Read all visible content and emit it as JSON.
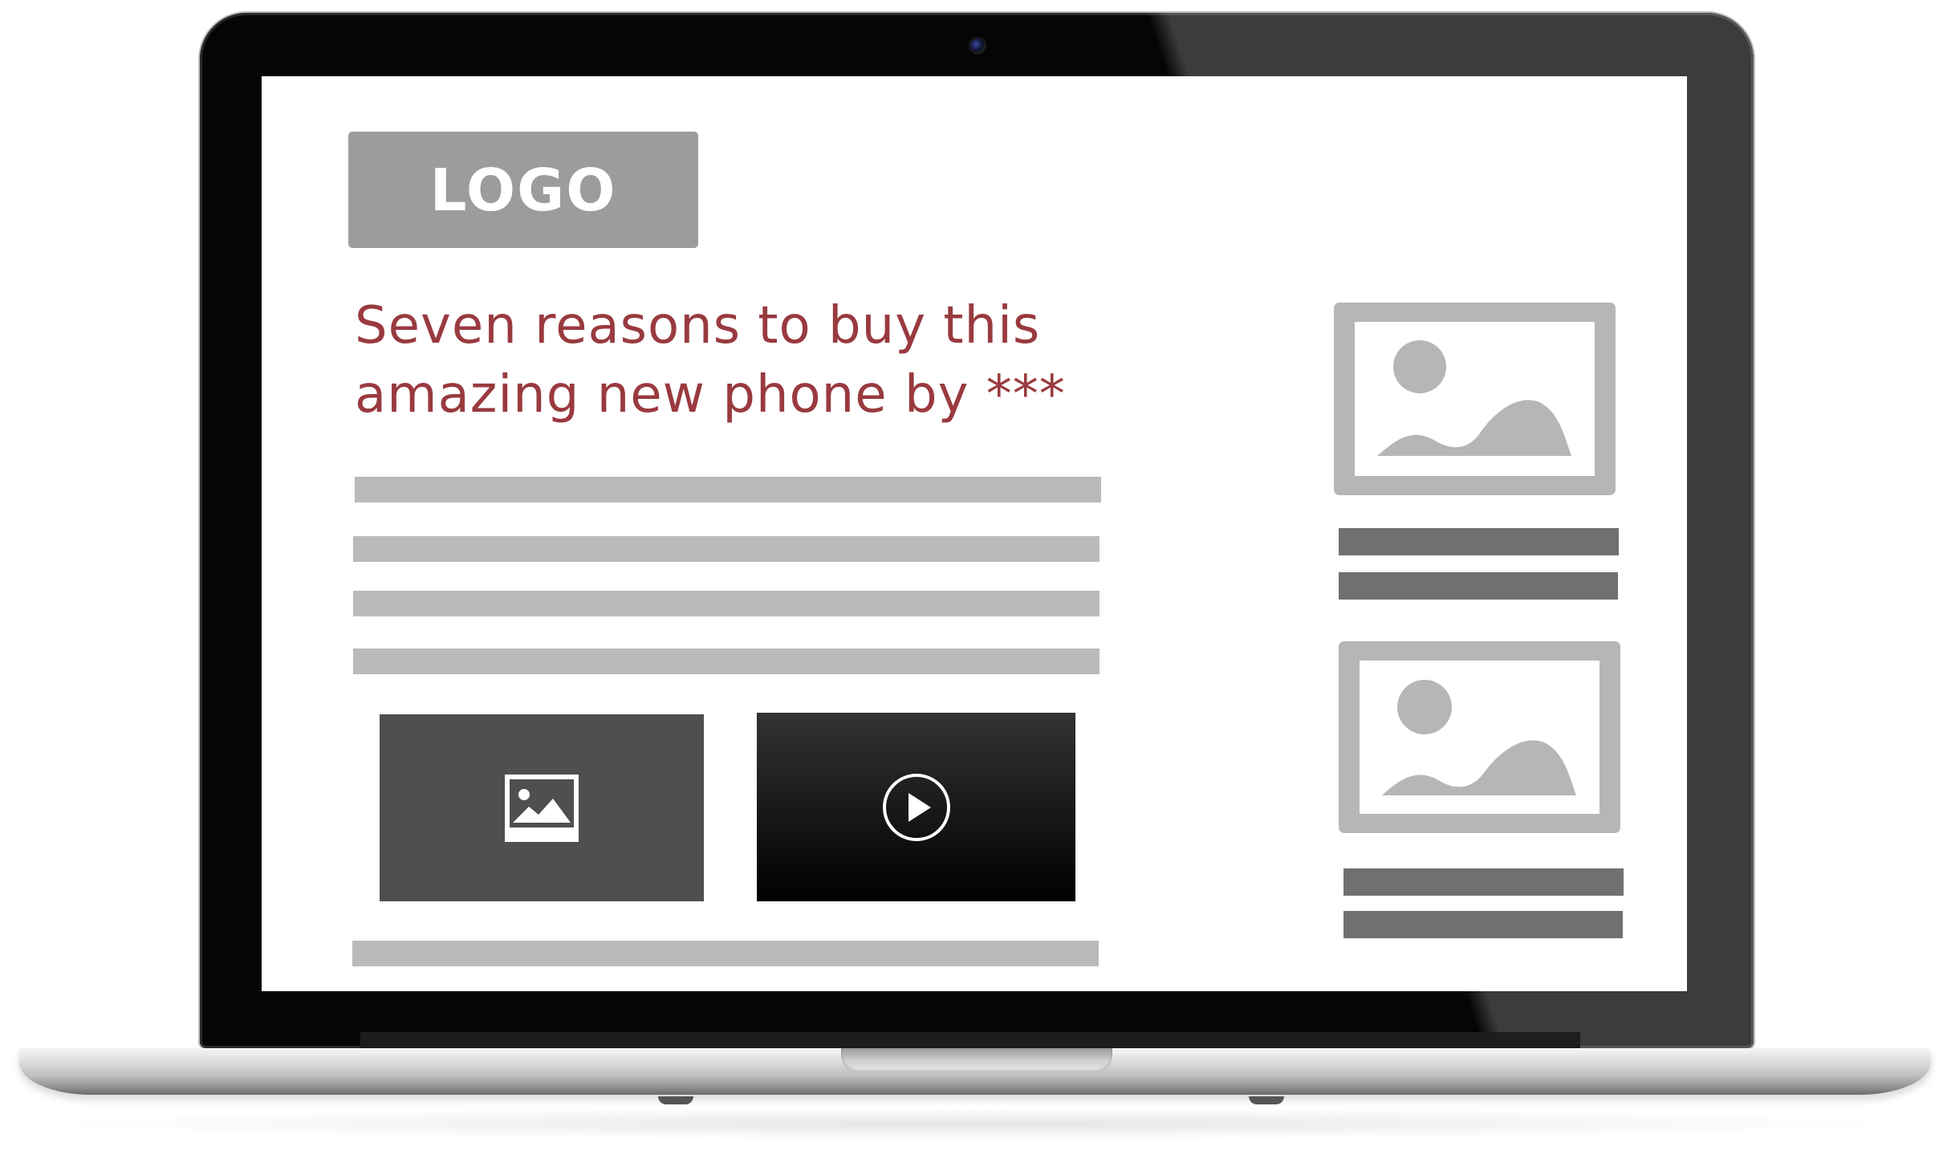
{
  "page": {
    "logo_text": "LOGO",
    "headline_line1": "Seven reasons to buy this",
    "headline_line2": "amazing new phone by ***"
  },
  "media": {
    "image_icon": "image-icon",
    "video_icon": "play-circle-icon"
  },
  "sidebar": {
    "placeholder_icon": "landscape-image-icon"
  },
  "colors": {
    "headline": "#993a3f",
    "logo_bg": "#9c9c9c",
    "text_placeholder": "#bababa",
    "sidebar_bar": "#707070",
    "image_thumb_bg": "#4f4f4f",
    "video_thumb_bg": "#000000"
  }
}
